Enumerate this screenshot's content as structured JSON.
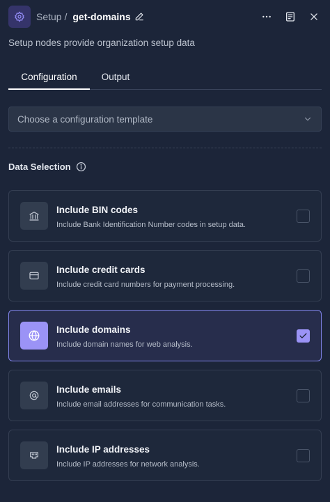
{
  "header": {
    "parent_label": "Setup /",
    "node_name": "get-domains",
    "icons": [
      "settings-gear-icon",
      "edit-pencil-icon",
      "more-options-icon",
      "notes-icon",
      "close-icon"
    ]
  },
  "subtitle": "Setup nodes provide organization setup data",
  "tabs": [
    {
      "label": "Configuration",
      "active": true
    },
    {
      "label": "Output",
      "active": false
    }
  ],
  "template_select": {
    "placeholder": "Choose a configuration template"
  },
  "data_selection": {
    "title": "Data Selection",
    "options": [
      {
        "title": "Include BIN codes",
        "description": "Include Bank Identification Number codes in setup data.",
        "icon": "bank-icon",
        "checked": false
      },
      {
        "title": "Include credit cards",
        "description": "Include credit card numbers for payment processing.",
        "icon": "credit-card-icon",
        "checked": false
      },
      {
        "title": "Include domains",
        "description": "Include domain names for web analysis.",
        "icon": "globe-icon",
        "checked": true
      },
      {
        "title": "Include emails",
        "description": "Include email addresses for communication tasks.",
        "icon": "at-sign-icon",
        "checked": false
      },
      {
        "title": "Include IP addresses",
        "description": "Include IP addresses for network analysis.",
        "icon": "network-port-icon",
        "checked": false
      }
    ]
  },
  "colors": {
    "background": "#1c2539",
    "accent": "#9b93f6",
    "selected_border": "#7f83e8",
    "card_border": "#343e52"
  }
}
